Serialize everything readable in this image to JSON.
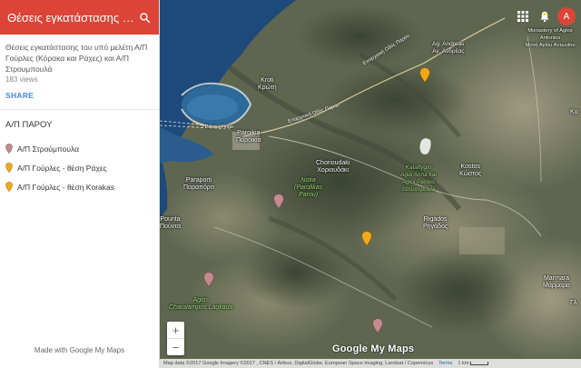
{
  "sidebar": {
    "title": "Θέσεις εγκατάστασης τ...",
    "description": "Θέσεις εγκατάστασης του υπό μελέτη Α/Π Γούρλες (Κόρακα και Ράχες) και Α/Π Στρουμπουλά",
    "views": "183 views",
    "share": "SHARE",
    "layer_title": "Α/Π ΠΑΡΟΥ",
    "items": [
      {
        "label": "Α/Π Στρούμπουλα",
        "color": "#c48a8e"
      },
      {
        "label": "Α/Π Γούρλες - θέση Ράχες",
        "color": "#f0a91c"
      },
      {
        "label": "Α/Π Γούρλες - θέση Korakas",
        "color": "#f0a91c"
      }
    ],
    "footer": "Made with Google My Maps"
  },
  "map": {
    "labels": {
      "ag_andreas": "Ag. Andreas\nΑγ. Ανδρέας",
      "monastery": "Monastery of Agios Antonios\nΜονή Αγίου Αντωνίου",
      "kroti": "Kroti\nΚρώτη",
      "paros_piraeus": "Paros - Pireas",
      "paroikia": "Paroikia\nΠαροικία",
      "chorioudaki": "Chorioudaki\nΧοριουδάκι",
      "kataflygio": "Kataflygio\nAgia Anna kai\nAgioi Pantes\nStroumpoula",
      "kostos": "Kostos\nΚώστος",
      "paraporti": "Paraporti\nΠαραπόρτι",
      "notia": "Notia\n(Parolikas\nParou)",
      "pounta": "Pounta\nΠούντα",
      "rigados": "Rigados\nΡηγάδος",
      "agios_charalampos": "Agios\nCharalampos Lagkada",
      "marmara": "Marmara\nΜάρμαρα",
      "ko_edge": "Κο",
      "gl_edge": "Γλ",
      "road_north": "Επαρχιακή Οδός Παρου",
      "road_mid": "Επαρχιακή Οδός Παρου"
    },
    "pins": [
      {
        "type": "Α/Π Γούρλες - θέση Ράχες",
        "color": "#f0a91c"
      },
      {
        "type": "Α/Π Στρούμπουλα",
        "color": "#c48a8e"
      },
      {
        "type": "Α/Π Γούρλες - θέση Korakas",
        "color": "#f0a91c"
      },
      {
        "type": "Α/Π Στρούμπουλα",
        "color": "#c48a8e"
      },
      {
        "type": "Α/Π Στρούμπουλα",
        "color": "#c48a8e"
      }
    ],
    "zoom_in": "+",
    "zoom_out": "−",
    "avatar_letter": "A",
    "logo": "Google My Maps",
    "attribution": "Map data ©2017 Google Imagery ©2017 , CNES / Airbus, DigitalGlobe, European Space Imaging, Landsat / Copernicus",
    "terms": "Terms",
    "scale": "1 km"
  },
  "colors": {
    "header": "#db4437",
    "share": "#4285f4",
    "pin_pink": "#c48a8e",
    "pin_yellow": "#f0a91c",
    "sea": "#2d5a8a"
  }
}
